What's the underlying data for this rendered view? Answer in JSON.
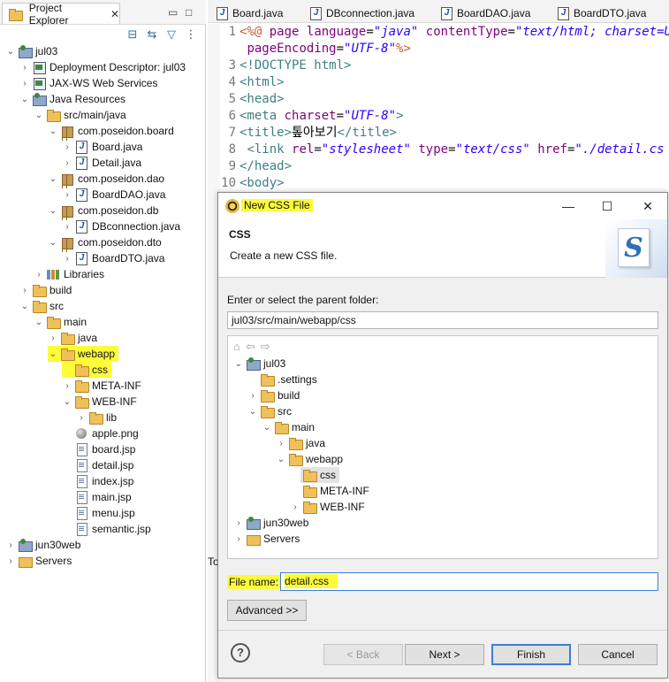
{
  "explorer": {
    "title": "Project Explorer",
    "close_glyph": "✕",
    "minimize_glyph": "▭",
    "maximize_glyph": "□",
    "items": [
      {
        "label": "jul03"
      },
      {
        "label": "Deployment Descriptor: jul03"
      },
      {
        "label": "JAX-WS Web Services"
      },
      {
        "label": "Java Resources"
      },
      {
        "label": "src/main/java"
      },
      {
        "label": "com.poseidon.board"
      },
      {
        "label": "Board.java"
      },
      {
        "label": "Detail.java"
      },
      {
        "label": "com.poseidon.dao"
      },
      {
        "label": "BoardDAO.java"
      },
      {
        "label": "com.poseidon.db"
      },
      {
        "label": "DBconnection.java"
      },
      {
        "label": "com.poseidon.dto"
      },
      {
        "label": "BoardDTO.java"
      },
      {
        "label": "Libraries"
      },
      {
        "label": "build"
      },
      {
        "label": "src"
      },
      {
        "label": "main"
      },
      {
        "label": "java"
      },
      {
        "label": "webapp"
      },
      {
        "label": "css"
      },
      {
        "label": "META-INF"
      },
      {
        "label": "WEB-INF"
      },
      {
        "label": "lib"
      },
      {
        "label": "apple.png"
      },
      {
        "label": "board.jsp"
      },
      {
        "label": "detail.jsp"
      },
      {
        "label": "index.jsp"
      },
      {
        "label": "main.jsp"
      },
      {
        "label": "menu.jsp"
      },
      {
        "label": "semantic.jsp"
      },
      {
        "label": "jun30web"
      },
      {
        "label": "Servers"
      }
    ]
  },
  "editor": {
    "tabs": [
      {
        "label": "Board.java"
      },
      {
        "label": "DBconnection.java"
      },
      {
        "label": "BoardDAO.java"
      },
      {
        "label": "BoardDTO.java"
      }
    ],
    "lines": {
      "n1": "1",
      "n2": "2",
      "n3": "3",
      "n4": "4",
      "n5": "5",
      "n6": "6",
      "n7": "7",
      "n8": "8",
      "n9": "9",
      "n10": "10",
      "l1_open": "<%@",
      "l1_page": "page",
      "l1_a1": "language",
      "l1_eq": "=",
      "l1_v1": "\"java\"",
      "l1_a2": "contentType",
      "l1_v2": "\"text/html; charset=UTF",
      "l2_a": "pageEncoding",
      "l2_eq": "=",
      "l2_v": "\"UTF-8\"",
      "l2_close": "%>",
      "l3": "<!DOCTYPE html>",
      "l4": "<html>",
      "l5": "<head>",
      "l6_tag": "<meta",
      "l6_attr": "charset",
      "l6_eq": "=",
      "l6_val": "\"UTF-8\"",
      "l6_close": ">",
      "l7_open": "<title>",
      "l7_text": "톺아보기",
      "l7_close": "</title>",
      "l8_tag": "<link",
      "l8_a1": "rel",
      "l8_v1": "\"stylesheet\"",
      "l8_a2": "type",
      "l8_v2": "\"text/css\"",
      "l8_a3": "href",
      "l8_v3": "\"./detail.cs",
      "l9": "</head>",
      "l10": "<body>",
      "bg_fragment": "To"
    }
  },
  "dialog": {
    "title": "New CSS File",
    "minimize_glyph": "—",
    "maximize_glyph": "☐",
    "close_glyph": "✕",
    "banner_title": "CSS",
    "banner_desc": "Create a new CSS file.",
    "banner_art_glyph": "S",
    "folder_label": "Enter or select the parent folder:",
    "folder_value": "jul03/src/main/webapp/css",
    "tree": [
      {
        "label": "jul03"
      },
      {
        "label": ".settings"
      },
      {
        "label": "build"
      },
      {
        "label": "src"
      },
      {
        "label": "main"
      },
      {
        "label": "java"
      },
      {
        "label": "webapp"
      },
      {
        "label": "css"
      },
      {
        "label": "META-INF"
      },
      {
        "label": "WEB-INF"
      },
      {
        "label": "jun30web"
      },
      {
        "label": "Servers"
      }
    ],
    "file_name_label": "File name:",
    "file_name_value": "detail.css",
    "advanced_label": "Advanced >>",
    "help_glyph": "?",
    "buttons": {
      "back": "< Back",
      "next": "Next >",
      "finish": "Finish",
      "cancel": "Cancel"
    }
  },
  "colors": {
    "highlight": "#fdfb3a",
    "focus_border": "#3c7fd4",
    "jsp_directive": "#bf5f3f",
    "tag": "#3f7f7f",
    "attribute": "#7f007f",
    "string": "#2a00ff"
  }
}
